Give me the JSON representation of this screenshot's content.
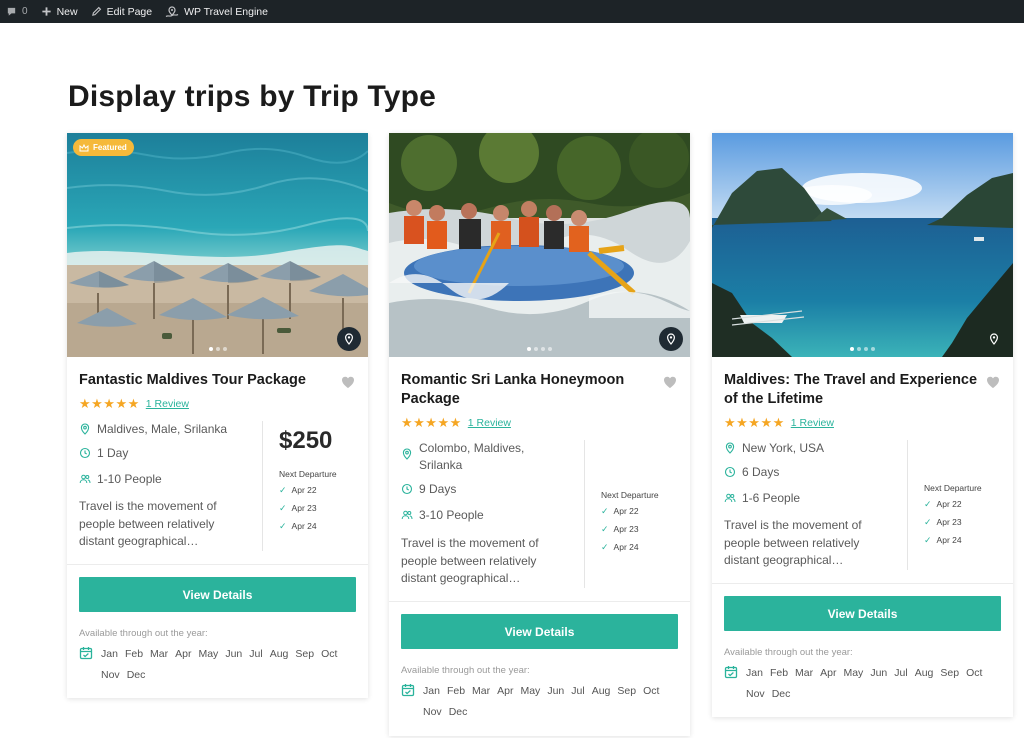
{
  "adminbar": {
    "comments_count": "0",
    "new_label": "New",
    "edit_label": "Edit Page",
    "plugin_label": "WP Travel Engine",
    "icons": [
      "comment-icon",
      "plus-icon",
      "pencil-icon",
      "travel-engine-icon"
    ]
  },
  "page": {
    "title": "Display trips by Trip Type"
  },
  "colors": {
    "accent": "#2bb39c",
    "star": "#f5a623",
    "featured": "#f5b93a",
    "adminbar": "#1d2327"
  },
  "cards": [
    {
      "featured": "Featured",
      "title": "Fantastic Maldives Tour Package",
      "review": "1 Review",
      "rating": 5,
      "location": "Maldives, Male, Srilanka",
      "duration": "1 Day",
      "people": "1-10 People",
      "description": "Travel is the movement of people between relatively distant geographical…",
      "price": "$250",
      "next_departure_label": "Next Departure",
      "departures": [
        "Apr 22",
        "Apr 23",
        "Apr 24"
      ],
      "button": "View Details",
      "availability": "Available through out the year:",
      "months": [
        "Jan",
        "Feb",
        "Mar",
        "Apr",
        "May",
        "Jun",
        "Jul",
        "Aug",
        "Sep",
        "Oct",
        "Nov",
        "Dec"
      ],
      "image": "beach-umbrellas-photo"
    },
    {
      "title": "Romantic Sri Lanka Honeymoon Package",
      "review": "1 Review",
      "rating": 5,
      "location": "Colombo, Maldives, Srilanka",
      "duration": "9 Days",
      "people": "3-10 People",
      "description": "Travel is the movement of people between relatively distant geographical…",
      "next_departure_label": "Next Departure",
      "departures": [
        "Apr 22",
        "Apr 23",
        "Apr 24"
      ],
      "button": "View Details",
      "availability": "Available through out the year:",
      "months": [
        "Jan",
        "Feb",
        "Mar",
        "Apr",
        "May",
        "Jun",
        "Jul",
        "Aug",
        "Sep",
        "Oct",
        "Nov",
        "Dec"
      ],
      "image": "river-rafting-photo"
    },
    {
      "title": "Maldives: The Travel and Experience of the Lifetime",
      "review": "1 Review",
      "rating": 5,
      "location": "New York, USA",
      "duration": "6 Days",
      "people": "1-6 People",
      "description": "Travel is the movement of people between relatively distant geographical…",
      "next_departure_label": "Next Departure",
      "departures": [
        "Apr 22",
        "Apr 23",
        "Apr 24"
      ],
      "button": "View Details",
      "availability": "Available through out the year:",
      "months": [
        "Jan",
        "Feb",
        "Mar",
        "Apr",
        "May",
        "Jun",
        "Jul",
        "Aug",
        "Sep",
        "Oct",
        "Nov",
        "Dec"
      ],
      "image": "lagoon-islands-photo"
    }
  ]
}
